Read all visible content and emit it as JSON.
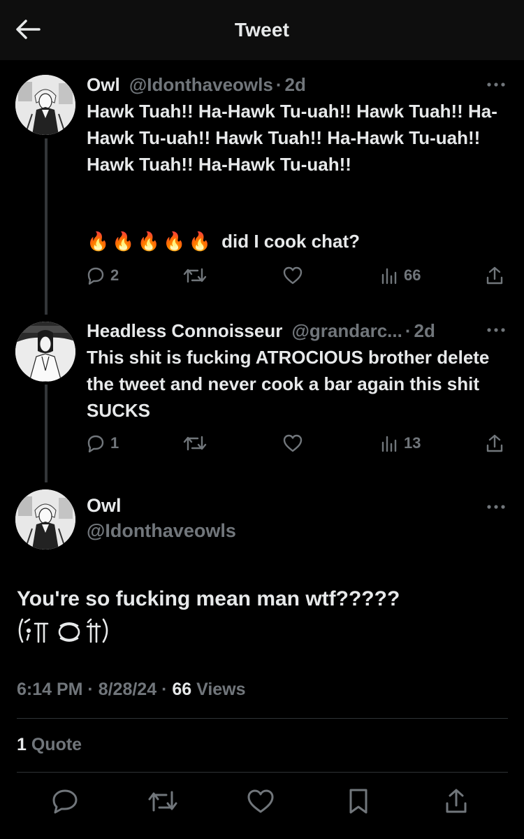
{
  "header": {
    "title": "Tweet",
    "back_icon": "arrow-left-icon"
  },
  "tweets": [
    {
      "name": "Owl",
      "handle": "@Idonthaveowls",
      "dot": "·",
      "time": "2d",
      "text": "Hawk Tuah!! Ha-Hawk Tu-uah!! Hawk Tuah!! Ha-Hawk Tu-uah!! Hawk Tuah!! Ha-Hawk Tu-uah!! Hawk Tuah!! Ha-Hawk Tu-uah!!",
      "emoji_line": "🔥🔥🔥🔥🔥",
      "emoji_caption": "did I cook chat?",
      "replies": "2",
      "views": "66"
    },
    {
      "name": "Headless Connoisseur",
      "handle": "@grandarc...",
      "dot": "·",
      "time": "2d",
      "text": "This shit is fucking ATROCIOUS brother delete the tweet and never cook a bar again this shit SUCKS",
      "replies": "1",
      "views": "13"
    }
  ],
  "main": {
    "name": "Owl",
    "handle": "@Idonthaveowls",
    "text": "You're so fucking mean man wtf?????",
    "kaomoji": "(;'̀ ̥ ̥ ̥')",
    "timestamp": "6:14 PM",
    "date": "8/28/24",
    "views_count": "66",
    "views_label": "Views",
    "quote_count": "1",
    "quote_label": "Quote"
  },
  "colors": {
    "background": "#000000",
    "header_bg": "#0e0e0e",
    "text": "#e7e9ea",
    "secondary": "#71767b",
    "divider": "#2f3336"
  }
}
